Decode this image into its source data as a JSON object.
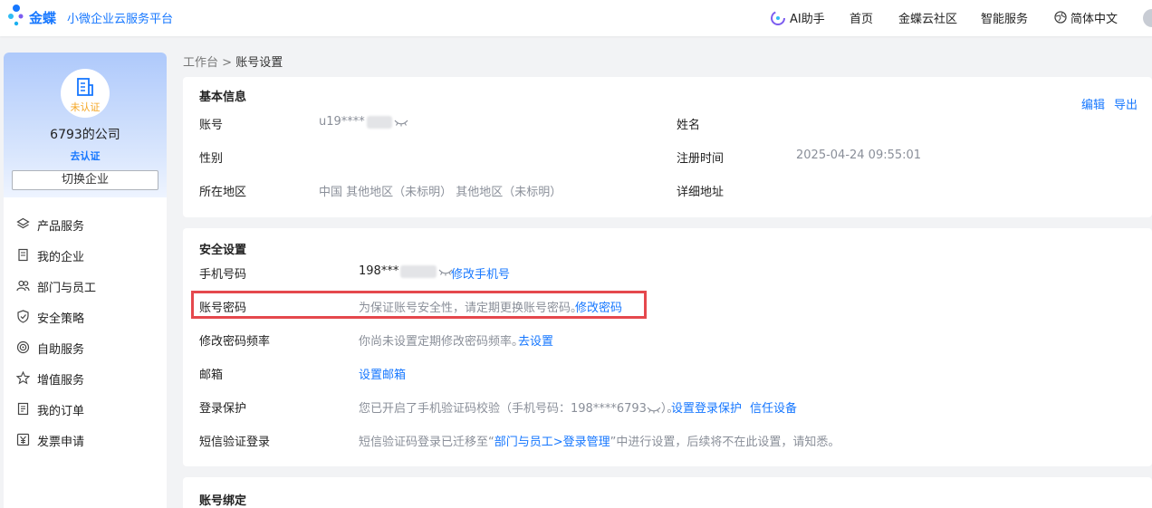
{
  "header": {
    "brand": "金蝶",
    "platform": "小微企业云服务平台",
    "nav": [
      "AI助手",
      "首页",
      "金蝶云社区",
      "智能服务",
      "简体中文"
    ]
  },
  "sidebar": {
    "company_status": "未认证",
    "company_name": "6793的公司",
    "verify_link": "去认证",
    "switch_button": "切换企业",
    "menu": [
      {
        "label": "产品服务",
        "icon": "layers-icon"
      },
      {
        "label": "我的企业",
        "icon": "document-icon"
      },
      {
        "label": "部门与员工",
        "icon": "people-icon"
      },
      {
        "label": "安全策略",
        "icon": "shield-icon"
      },
      {
        "label": "自助服务",
        "icon": "target-icon"
      },
      {
        "label": "增值服务",
        "icon": "star-icon"
      },
      {
        "label": "我的订单",
        "icon": "list-icon"
      },
      {
        "label": "发票申请",
        "icon": "yen-icon"
      }
    ]
  },
  "breadcrumb": {
    "parent": "工作台",
    "separator": ">",
    "current": "账号设置"
  },
  "basic_info": {
    "title": "基本信息",
    "edit": "编辑",
    "export": "导出",
    "account_label": "账号",
    "account_value": "u19****",
    "name_label": "姓名",
    "gender_label": "性别",
    "register_time_label": "注册时间",
    "register_time_value": "2025-04-24 09:55:01",
    "region_label": "所在地区",
    "region_value": "中国 其他地区（未标明） 其他地区（未标明）",
    "address_label": "详细地址"
  },
  "security": {
    "title": "安全设置",
    "phone_label": "手机号码",
    "phone_value": "198***",
    "phone_action": "修改手机号",
    "password_label": "账号密码",
    "password_desc": "为保证账号安全性，请定期更换账号密码。",
    "password_action": "修改密码",
    "pwd_freq_label": "修改密码频率",
    "pwd_freq_desc": "你尚未设置定期修改密码频率。",
    "pwd_freq_action": "去设置",
    "email_label": "邮箱",
    "email_action": "设置邮箱",
    "login_protect_label": "登录保护",
    "login_protect_desc_a": "您已开启了手机验证码校验（手机号码：198****6793",
    "login_protect_desc_b": "）。",
    "login_protect_action": "设置登录保护",
    "trusted_devices": "信任设备",
    "sms_login_label": "短信验证登录",
    "sms_login_desc_a": "短信验证码登录已迁移至",
    "sms_login_link": "部门与员工>登录管理",
    "sms_login_desc_b": "中进行设置，后续将不在此设置，请知悉。"
  },
  "binding": {
    "title": "账号绑定"
  },
  "colors": {
    "accent": "#1677ff",
    "highlight": "#e5484d",
    "warning": "#f5a623"
  }
}
